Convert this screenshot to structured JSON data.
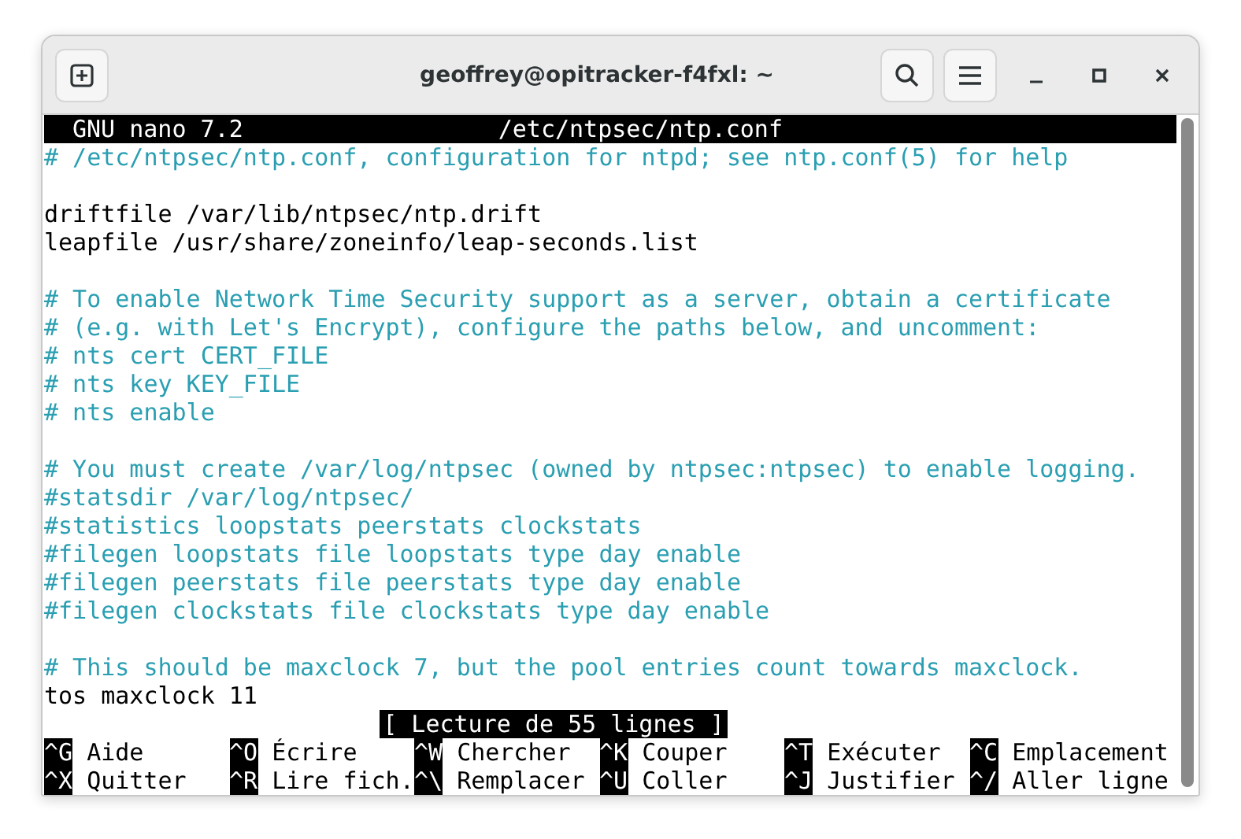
{
  "window": {
    "title": "geoffrey@opitracker-f4fxl: ~"
  },
  "nano_header": {
    "version": "GNU nano 7.2",
    "filename": "/etc/ntpsec/ntp.conf"
  },
  "lines": [
    {
      "kind": "comment",
      "text": "# /etc/ntpsec/ntp.conf, configuration for ntpd; see ntp.conf(5) for help"
    },
    {
      "kind": "blank"
    },
    {
      "kind": "text",
      "text": "driftfile /var/lib/ntpsec/ntp.drift"
    },
    {
      "kind": "text",
      "text": "leapfile /usr/share/zoneinfo/leap-seconds.list"
    },
    {
      "kind": "blank"
    },
    {
      "kind": "comment",
      "text": "# To enable Network Time Security support as a server, obtain a certificate"
    },
    {
      "kind": "comment",
      "text": "# (e.g. with Let's Encrypt), configure the paths below, and uncomment:"
    },
    {
      "kind": "comment",
      "text": "# nts cert CERT_FILE"
    },
    {
      "kind": "comment",
      "text": "# nts key KEY_FILE"
    },
    {
      "kind": "comment",
      "text": "# nts enable"
    },
    {
      "kind": "blank"
    },
    {
      "kind": "comment",
      "text": "# You must create /var/log/ntpsec (owned by ntpsec:ntpsec) to enable logging."
    },
    {
      "kind": "comment",
      "text": "#statsdir /var/log/ntpsec/"
    },
    {
      "kind": "comment",
      "text": "#statistics loopstats peerstats clockstats"
    },
    {
      "kind": "comment",
      "text": "#filegen loopstats file loopstats type day enable"
    },
    {
      "kind": "comment",
      "text": "#filegen peerstats file peerstats type day enable"
    },
    {
      "kind": "comment",
      "text": "#filegen clockstats file clockstats type day enable"
    },
    {
      "kind": "blank"
    },
    {
      "kind": "comment",
      "text": "# This should be maxclock 7, but the pool entries count towards maxclock."
    },
    {
      "kind": "text",
      "text": "tos maxclock 11"
    }
  ],
  "status_message": "[ Lecture de 55 lignes ]",
  "shortcuts": [
    [
      {
        "key": "^G",
        "label": "Aide"
      },
      {
        "key": "^O",
        "label": "Écrire"
      },
      {
        "key": "^W",
        "label": "Chercher"
      },
      {
        "key": "^K",
        "label": "Couper"
      },
      {
        "key": "^T",
        "label": "Exécuter"
      },
      {
        "key": "^C",
        "label": "Emplacement"
      }
    ],
    [
      {
        "key": "^X",
        "label": "Quitter"
      },
      {
        "key": "^R",
        "label": "Lire fich."
      },
      {
        "key": "^\\",
        "label": "Remplacer"
      },
      {
        "key": "^U",
        "label": "Coller"
      },
      {
        "key": "^J",
        "label": "Justifier"
      },
      {
        "key": "^/",
        "label": "Aller ligne"
      }
    ]
  ]
}
